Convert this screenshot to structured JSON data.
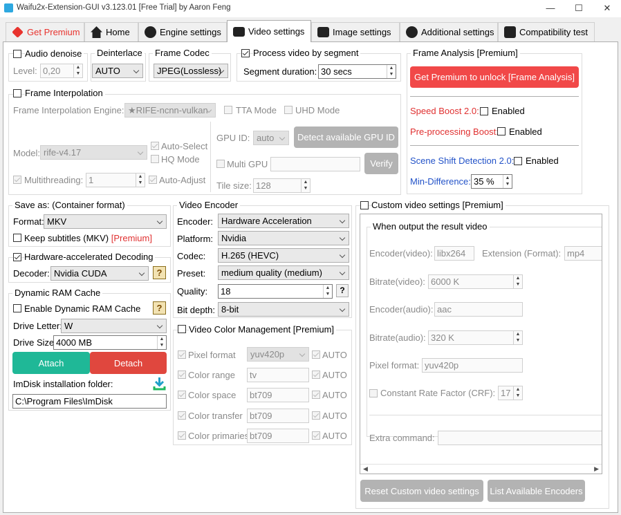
{
  "window": {
    "title": "Waifu2x-Extension-GUI v3.123.01 [Free Trial] by Aaron Feng",
    "minimize": "—",
    "maximize": "☐",
    "close": "✕"
  },
  "tabs": [
    {
      "label": "Get Premium",
      "icon": "gem-icon",
      "color": "#e8332e"
    },
    {
      "label": "Home",
      "icon": "home-icon"
    },
    {
      "label": "Engine settings",
      "icon": "engine-icon"
    },
    {
      "label": "Video settings",
      "icon": "clapper-icon"
    },
    {
      "label": "Image settings",
      "icon": "image-icon"
    },
    {
      "label": "Additional settings",
      "icon": "gear-icon"
    },
    {
      "label": "Compatibility test",
      "icon": "checklist-icon"
    }
  ],
  "audio": {
    "label": "Audio denoise",
    "level_label": "Level:",
    "level_value": "0,20",
    "checked": false
  },
  "deinterlace": {
    "legend": "Deinterlace",
    "value": "AUTO"
  },
  "frame_codec": {
    "legend": "Frame Codec",
    "value": "JPEG(Lossless)"
  },
  "segment": {
    "label": "Process video by segment",
    "checked": true,
    "duration_label": "Segment duration:",
    "duration_value": "30 secs"
  },
  "frame_analysis": {
    "legend": "Frame Analysis [Premium]",
    "unlock_button": "Get Premium to unlock [Frame Analysis]",
    "speed_boost_label": "Speed Boost 2.0:",
    "preprocessing_label": "Pre-processing Boost:",
    "scene_shift_label": "Scene Shift Detection 2.0:",
    "min_diff_label": "Min-Difference:",
    "min_diff_value": "35 %",
    "enabled": "Enabled"
  },
  "interpolation": {
    "label": "Frame Interpolation",
    "engine_label": "Frame Interpolation Engine:",
    "engine_value": "★RIFE-ncnn-vulkan",
    "tta": "TTA Mode",
    "uhd": "UHD Mode",
    "model_label": "Model:",
    "model_value": "rife-v4.17",
    "auto_select": "Auto-Select",
    "hq_mode": "HQ Mode",
    "multithreading": "Multithreading:",
    "threads_value": "1",
    "auto_adjust": "Auto-Adjust",
    "gpu_id_label": "GPU ID:",
    "gpu_id_value": "auto",
    "detect_button": "Detect available GPU ID",
    "multi_gpu": "Multi GPU",
    "verify_button": "Verify",
    "tile_label": "Tile size:",
    "tile_value": "128"
  },
  "save_as": {
    "legend": "Save as: (Container format)",
    "format_label": "Format:",
    "format_value": "MKV",
    "keep_subs": "Keep subtitles (MKV)",
    "premium": "[Premium]"
  },
  "hw_decode": {
    "label": "Hardware-accelerated Decoding",
    "checked": true,
    "decoder_label": "Decoder:",
    "decoder_value": "Nvidia CUDA",
    "help": "?"
  },
  "ram_cache": {
    "legend": "Dynamic RAM Cache",
    "enable_label": "Enable Dynamic RAM Cache",
    "help": "?",
    "drive_letter_label": "Drive Letter:",
    "drive_letter_value": "W",
    "drive_size_label": "Drive Size:",
    "drive_size_value": "4000 MB",
    "attach": "Attach",
    "detach": "Detach",
    "imdisk_label": "ImDisk installation folder:",
    "imdisk_path": "C:\\Program Files\\ImDisk"
  },
  "encoder": {
    "legend": "Video Encoder",
    "encoder_label": "Encoder:",
    "encoder_value": "Hardware Acceleration",
    "platform_label": "Platform:",
    "platform_value": "Nvidia",
    "codec_label": "Codec:",
    "codec_value": "H.265 (HEVC)",
    "preset_label": "Preset:",
    "preset_value": "medium quality (medium)",
    "quality_label": "Quality:",
    "quality_value": "18",
    "quality_help": "?",
    "bitdepth_label": "Bit depth:",
    "bitdepth_value": "8-bit"
  },
  "color_mgmt": {
    "label": "Video Color Management [Premium]",
    "rows": [
      {
        "label": "Pixel format",
        "value": "yuv420p",
        "auto": "AUTO"
      },
      {
        "label": "Color range",
        "value": "tv",
        "auto": "AUTO"
      },
      {
        "label": "Color space",
        "value": "bt709",
        "auto": "AUTO"
      },
      {
        "label": "Color transfer",
        "value": "bt709",
        "auto": "AUTO"
      },
      {
        "label": "Color primaries",
        "value": "bt709",
        "auto": "AUTO"
      }
    ]
  },
  "custom": {
    "label": "Custom video settings [Premium]",
    "group_legend": "When output the result video",
    "enc_video_label": "Encoder(video):",
    "enc_video_value": "libx264",
    "ext_label": "Extension (Format):",
    "ext_value": "mp4",
    "bitrate_video_label": "Bitrate(video):",
    "bitrate_video_value": "6000 K",
    "enc_audio_label": "Encoder(audio):",
    "enc_audio_value": "aac",
    "bitrate_audio_label": "Bitrate(audio):",
    "bitrate_audio_value": "320 K",
    "pixfmt_label": "Pixel format:",
    "pixfmt_value": "yuv420p",
    "crf_label": "Constant Rate Factor (CRF):",
    "crf_value": "17",
    "extra_label": "Extra command:",
    "reset_button": "Reset Custom video settings",
    "list_button": "List Available Encoders"
  }
}
